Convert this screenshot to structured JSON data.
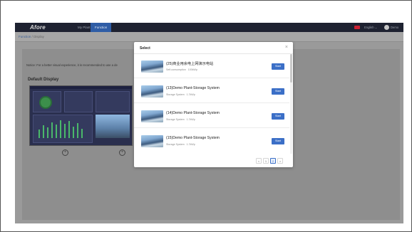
{
  "header": {
    "logo": "Afore",
    "nav": [
      "My Plant",
      "Function"
    ],
    "language": "English ⌄",
    "user": "Demo"
  },
  "breadcrumb": {
    "root": "Function",
    "separator": "/",
    "current": "Display"
  },
  "notice": "Notice: For a better visual experience, it is recommended to use a de",
  "default_display": {
    "title": "Default Display"
  },
  "modal": {
    "title": "Select",
    "close": "×",
    "items": [
      {
        "name": "(25)商业用余电上网演示电站",
        "meta_label": "Self-consumption",
        "meta_value": "100kWp",
        "button": "Start"
      },
      {
        "name": "(13)Demo Plant-Storage System",
        "meta_label": "Storage System",
        "meta_value": "1.7kWp",
        "button": "Start"
      },
      {
        "name": "(14)Demo Plant-Storage System",
        "meta_label": "Storage System",
        "meta_value": "1.7kWp",
        "button": "Start"
      },
      {
        "name": "(15)Demo Plant-Storage System",
        "meta_label": "Storage System",
        "meta_value": "1.7kWp",
        "button": "Start"
      }
    ],
    "pagination": {
      "prev": "<",
      "pages": [
        "1",
        "2"
      ],
      "current": "2",
      "next": ">"
    }
  },
  "colors": {
    "accent": "#3b6fc7",
    "topbar": "#1e2231",
    "overlay": "#9a9a9a"
  }
}
